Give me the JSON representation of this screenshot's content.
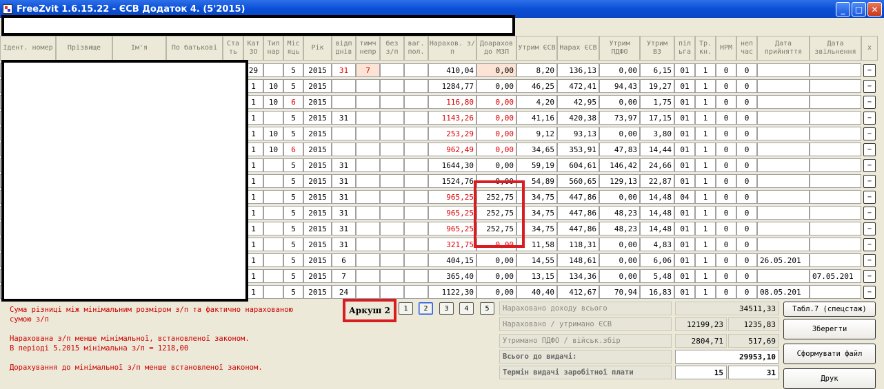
{
  "window": {
    "title": "FreeZvit 1.6.15.22 - ЄСВ Додаток 4. (5'2015)"
  },
  "headers": [
    "Ідент. номер",
    "Прізвище",
    "Ім'я",
    "По батькові",
    "Ста ть",
    "Кат ЗО",
    "Тип нар",
    "Міс яць",
    "Рік",
    "відп днів",
    "тимч непр",
    "без з/п",
    "ваг. пол.",
    "Нарахов. з/п",
    "Доарахов до МЗП",
    "Утрим ЄСВ",
    "Нарах ЄСВ",
    "Утрим ПДФО",
    "Утрим ВЗ",
    "пiл ьга",
    "Тр. кн.",
    "НРМ",
    "неп час",
    "Дата прийняття",
    "Дата звільнення",
    "x"
  ],
  "rows": [
    {
      "kat": "29",
      "typ": "",
      "mis": "5",
      "rik": "2015",
      "vidp": "31",
      "tymch": "7",
      "nar": "410,04",
      "doar": "0,00",
      "utr_esv": "8,20",
      "nar_esv": "136,13",
      "pdfo": "0,00",
      "vz": "6,15",
      "pilga": "01",
      "tr": "1",
      "nrm": "0",
      "nep": "0",
      "d1": "",
      "d2": "",
      "red": false,
      "mis_red": false
    },
    {
      "kat": "1",
      "typ": "10",
      "mis": "5",
      "rik": "2015",
      "vidp": "",
      "tymch": "",
      "nar": "1284,77",
      "doar": "0,00",
      "utr_esv": "46,25",
      "nar_esv": "472,41",
      "pdfo": "94,43",
      "vz": "19,27",
      "pilga": "01",
      "tr": "1",
      "nrm": "0",
      "nep": "0",
      "d1": "",
      "d2": "",
      "red": false,
      "mis_red": false
    },
    {
      "kat": "1",
      "typ": "10",
      "mis": "6",
      "rik": "2015",
      "vidp": "",
      "tymch": "",
      "nar": "116,80",
      "doar": "0,00",
      "utr_esv": "4,20",
      "nar_esv": "42,95",
      "pdfo": "0,00",
      "vz": "1,75",
      "pilga": "01",
      "tr": "1",
      "nrm": "0",
      "nep": "0",
      "d1": "",
      "d2": "",
      "red": true,
      "mis_red": true
    },
    {
      "kat": "1",
      "typ": "",
      "mis": "5",
      "rik": "2015",
      "vidp": "31",
      "tymch": "",
      "nar": "1143,26",
      "doar": "0,00",
      "utr_esv": "41,16",
      "nar_esv": "420,38",
      "pdfo": "73,97",
      "vz": "17,15",
      "pilga": "01",
      "tr": "1",
      "nrm": "0",
      "nep": "0",
      "d1": "",
      "d2": "",
      "red": true,
      "mis_red": false
    },
    {
      "kat": "1",
      "typ": "10",
      "mis": "5",
      "rik": "2015",
      "vidp": "",
      "tymch": "",
      "nar": "253,29",
      "doar": "0,00",
      "utr_esv": "9,12",
      "nar_esv": "93,13",
      "pdfo": "0,00",
      "vz": "3,80",
      "pilga": "01",
      "tr": "1",
      "nrm": "0",
      "nep": "0",
      "d1": "",
      "d2": "",
      "red": true,
      "mis_red": false
    },
    {
      "kat": "1",
      "typ": "10",
      "mis": "6",
      "rik": "2015",
      "vidp": "",
      "tymch": "",
      "nar": "962,49",
      "doar": "0,00",
      "utr_esv": "34,65",
      "nar_esv": "353,91",
      "pdfo": "47,83",
      "vz": "14,44",
      "pilga": "01",
      "tr": "1",
      "nrm": "0",
      "nep": "0",
      "d1": "",
      "d2": "",
      "red": true,
      "mis_red": true
    },
    {
      "kat": "1",
      "typ": "",
      "mis": "5",
      "rik": "2015",
      "vidp": "31",
      "tymch": "",
      "nar": "1644,30",
      "doar": "0,00",
      "utr_esv": "59,19",
      "nar_esv": "604,61",
      "pdfo": "146,42",
      "vz": "24,66",
      "pilga": "01",
      "tr": "1",
      "nrm": "0",
      "nep": "0",
      "d1": "",
      "d2": "",
      "red": false,
      "mis_red": false
    },
    {
      "kat": "1",
      "typ": "",
      "mis": "5",
      "rik": "2015",
      "vidp": "31",
      "tymch": "",
      "nar": "1524,76",
      "doar": "0,00",
      "utr_esv": "54,89",
      "nar_esv": "560,65",
      "pdfo": "129,13",
      "vz": "22,87",
      "pilga": "01",
      "tr": "1",
      "nrm": "0",
      "nep": "0",
      "d1": "",
      "d2": "",
      "red": false,
      "mis_red": false
    },
    {
      "kat": "1",
      "typ": "",
      "mis": "5",
      "rik": "2015",
      "vidp": "31",
      "tymch": "",
      "nar": "965,25",
      "doar": "252,75",
      "utr_esv": "34,75",
      "nar_esv": "447,86",
      "pdfo": "0,00",
      "vz": "14,48",
      "pilga": "04",
      "tr": "1",
      "nrm": "0",
      "nep": "0",
      "d1": "",
      "d2": "",
      "red": true,
      "mis_red": false
    },
    {
      "kat": "1",
      "typ": "",
      "mis": "5",
      "rik": "2015",
      "vidp": "31",
      "tymch": "",
      "nar": "965,25",
      "doar": "252,75",
      "utr_esv": "34,75",
      "nar_esv": "447,86",
      "pdfo": "48,23",
      "vz": "14,48",
      "pilga": "01",
      "tr": "1",
      "nrm": "0",
      "nep": "0",
      "d1": "",
      "d2": "",
      "red": true,
      "mis_red": false
    },
    {
      "kat": "1",
      "typ": "",
      "mis": "5",
      "rik": "2015",
      "vidp": "31",
      "tymch": "",
      "nar": "965,25",
      "doar": "252,75",
      "utr_esv": "34,75",
      "nar_esv": "447,86",
      "pdfo": "48,23",
      "vz": "14,48",
      "pilga": "01",
      "tr": "1",
      "nrm": "0",
      "nep": "0",
      "d1": "",
      "d2": "",
      "red": true,
      "mis_red": false
    },
    {
      "kat": "1",
      "typ": "",
      "mis": "5",
      "rik": "2015",
      "vidp": "31",
      "tymch": "",
      "nar": "321,75",
      "doar": "0,00",
      "utr_esv": "11,58",
      "nar_esv": "118,31",
      "pdfo": "0,00",
      "vz": "4,83",
      "pilga": "01",
      "tr": "1",
      "nrm": "0",
      "nep": "0",
      "d1": "",
      "d2": "",
      "red": true,
      "mis_red": false
    },
    {
      "kat": "1",
      "typ": "",
      "mis": "5",
      "rik": "2015",
      "vidp": "6",
      "tymch": "",
      "nar": "404,15",
      "doar": "0,00",
      "utr_esv": "14,55",
      "nar_esv": "148,61",
      "pdfo": "0,00",
      "vz": "6,06",
      "pilga": "01",
      "tr": "1",
      "nrm": "0",
      "nep": "0",
      "d1": "26.05.201",
      "d2": "",
      "red": false,
      "mis_red": false
    },
    {
      "kat": "1",
      "typ": "",
      "mis": "5",
      "rik": "2015",
      "vidp": "7",
      "tymch": "",
      "nar": "365,40",
      "doar": "0,00",
      "utr_esv": "13,15",
      "nar_esv": "134,36",
      "pdfo": "0,00",
      "vz": "5,48",
      "pilga": "01",
      "tr": "1",
      "nrm": "0",
      "nep": "0",
      "d1": "",
      "d2": "07.05.201",
      "red": false,
      "mis_red": false
    },
    {
      "kat": "1",
      "typ": "",
      "mis": "5",
      "rik": "2015",
      "vidp": "24",
      "tymch": "",
      "nar": "1122,30",
      "doar": "0,00",
      "utr_esv": "40,40",
      "nar_esv": "412,67",
      "pdfo": "70,94",
      "vz": "16,83",
      "pilga": "01",
      "tr": "1",
      "nrm": "0",
      "nep": "0",
      "d1": "08.05.201",
      "d2": "",
      "red": false,
      "mis_red": false
    }
  ],
  "row_button_label": "−",
  "messages": [
    "Сума різниці між мінімальним розміром з/п та фактично нарахованою\nсумою з/п",
    "Нарахована з/п менше мінімальної, встановленої законом.\nВ періоді 5.2015 мінімальна з/п = 1218,00",
    "Дорахування до мінімальної з/п менше встановленої законом."
  ],
  "sheet": {
    "label": "Аркуш 2"
  },
  "pages": [
    "1",
    "2",
    "3",
    "4",
    "5"
  ],
  "summary": {
    "income_label": "Нараховано доходу всього",
    "income_value": "34511,33",
    "esv_label": "Нараховано / утримано ЄСВ",
    "esv_accrued": "12199,23",
    "esv_withheld": "1235,83",
    "pdfo_label": "Утримано ПДФО / військ.збір",
    "pdfo_value": "2804,71",
    "vz_value": "517,69",
    "total_label": "Всього до видачі:",
    "total_value": "29953,10",
    "term_label": "Термін видачі заробітної плати",
    "term_from": "15",
    "term_to": "31"
  },
  "buttons": {
    "tabl7": "Табл.7 (спецстаж)",
    "save": "Зберегти",
    "form_file": "Сформувати файл",
    "print": "Друк"
  },
  "colors": {
    "accent_red": "#d91c22",
    "text_red": "#d00000",
    "title_blue": "#0a4fd6"
  }
}
